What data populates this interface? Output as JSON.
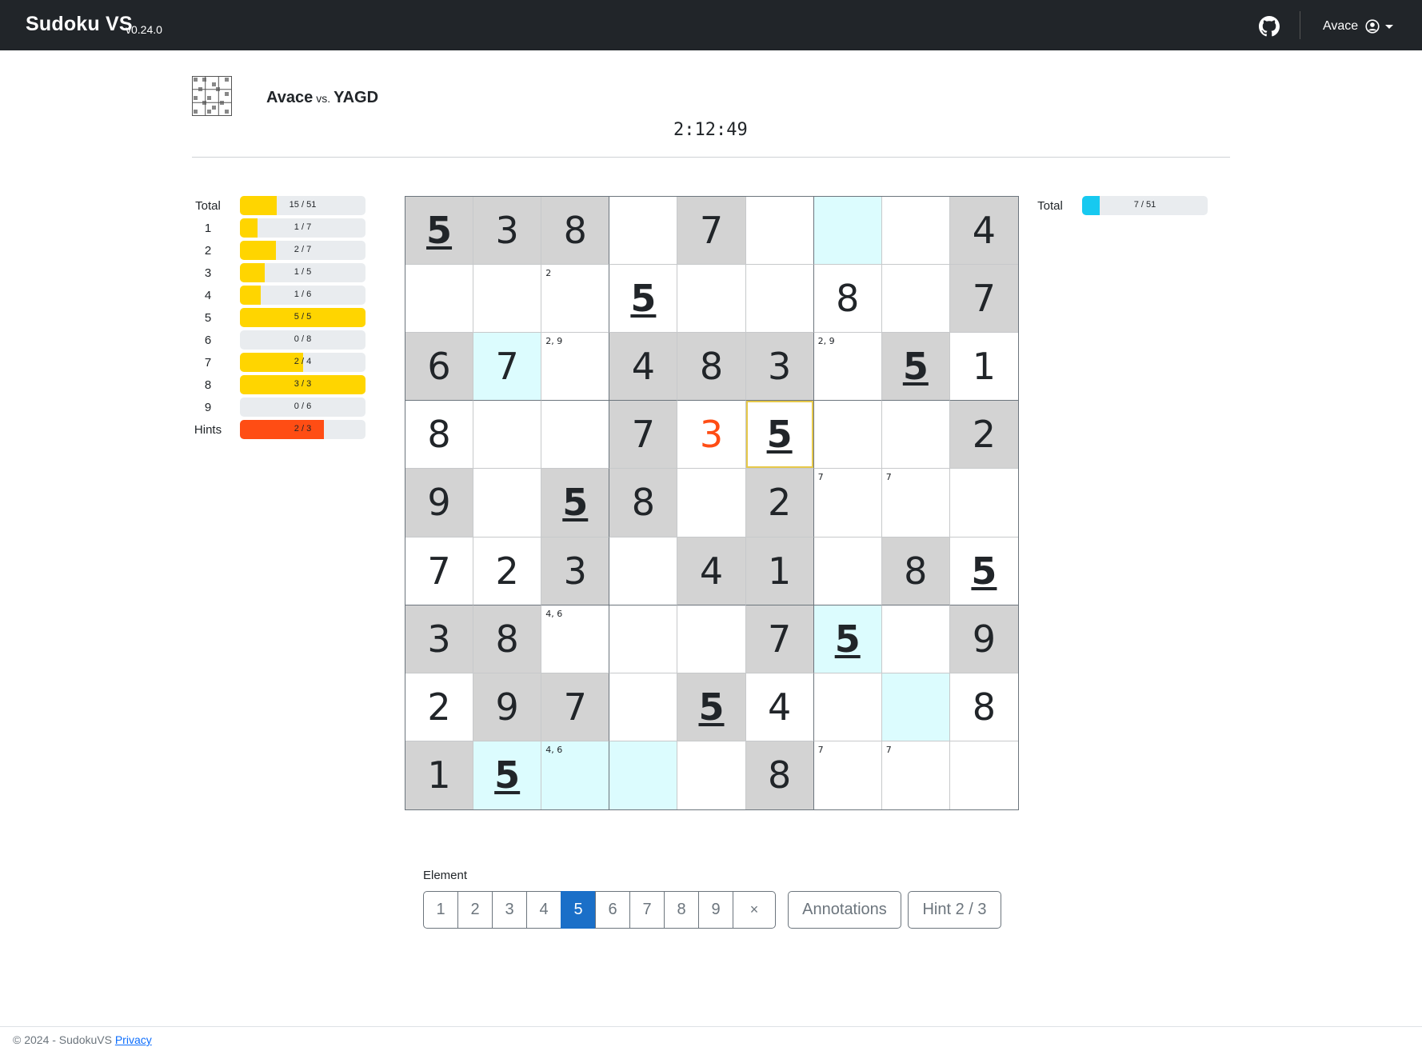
{
  "navbar": {
    "brand": "Sudoku VS",
    "version": "v0.24.0",
    "user": "Avace",
    "icons": [
      "github-icon",
      "user-circle-icon",
      "caret-down-icon"
    ]
  },
  "match": {
    "player1": "Avace",
    "vs": "vs.",
    "player2": "YAGD",
    "timer": "2:12:49"
  },
  "colors": {
    "navbar": "#212529",
    "player_fill": "#ffd500",
    "opponent_fill": "#17c9f0",
    "hints_fill": "#ff4d14",
    "highlight": "#dcfcfe",
    "given": "#d3d3d3",
    "error": "#ff4d14",
    "active_button": "#1a6fc8"
  },
  "player_stats": [
    {
      "label": "Total",
      "text": "15 / 51",
      "fraction": 0.294,
      "type": "normal"
    },
    {
      "label": "1",
      "text": "1 / 7",
      "fraction": 0.143,
      "type": "normal"
    },
    {
      "label": "2",
      "text": "2 / 7",
      "fraction": 0.286,
      "type": "normal"
    },
    {
      "label": "3",
      "text": "1 / 5",
      "fraction": 0.2,
      "type": "normal"
    },
    {
      "label": "4",
      "text": "1 / 6",
      "fraction": 0.167,
      "type": "normal"
    },
    {
      "label": "5",
      "text": "5 / 5",
      "fraction": 1.0,
      "type": "normal"
    },
    {
      "label": "6",
      "text": "0 / 8",
      "fraction": 0.0,
      "type": "normal"
    },
    {
      "label": "7",
      "text": "2 / 4",
      "fraction": 0.5,
      "type": "normal"
    },
    {
      "label": "8",
      "text": "3 / 3",
      "fraction": 1.0,
      "type": "normal"
    },
    {
      "label": "9",
      "text": "0 / 6",
      "fraction": 0.0,
      "type": "normal"
    },
    {
      "label": "Hints",
      "text": "2 / 3",
      "fraction": 0.667,
      "type": "hints"
    }
  ],
  "opponent_stats": [
    {
      "label": "Total",
      "text": "7 / 51",
      "fraction": 0.137,
      "type": "opponent"
    }
  ],
  "board": [
    [
      "5",
      "3",
      "8",
      "",
      "7",
      "",
      "",
      "",
      "4"
    ],
    [
      "",
      "",
      "",
      "5",
      "",
      "",
      "8",
      "",
      "7"
    ],
    [
      "6",
      "7",
      "",
      "4",
      "8",
      "3",
      "",
      "5",
      "1"
    ],
    [
      "8",
      "",
      "",
      "7",
      "3",
      "5",
      "",
      "",
      "2"
    ],
    [
      "9",
      "",
      "5",
      "8",
      "",
      "2",
      "",
      "",
      ""
    ],
    [
      "7",
      "2",
      "3",
      "",
      "4",
      "1",
      "",
      "8",
      "5"
    ],
    [
      "3",
      "8",
      "",
      "",
      "",
      "7",
      "5",
      "",
      "9"
    ],
    [
      "2",
      "9",
      "7",
      "",
      "5",
      "4",
      "",
      "",
      "8"
    ],
    [
      "1",
      "5",
      "",
      "",
      "",
      "8",
      "",
      "",
      ""
    ]
  ],
  "given": [
    [
      1,
      1,
      1,
      0,
      1,
      0,
      0,
      0,
      1
    ],
    [
      0,
      0,
      0,
      0,
      0,
      0,
      0,
      0,
      1
    ],
    [
      1,
      0,
      0,
      1,
      1,
      1,
      0,
      1,
      0
    ],
    [
      0,
      0,
      0,
      1,
      0,
      0,
      0,
      0,
      1
    ],
    [
      1,
      0,
      1,
      1,
      0,
      1,
      0,
      0,
      0
    ],
    [
      0,
      0,
      1,
      0,
      1,
      1,
      0,
      1,
      0
    ],
    [
      1,
      1,
      0,
      0,
      0,
      1,
      0,
      0,
      1
    ],
    [
      0,
      1,
      1,
      0,
      1,
      0,
      0,
      0,
      0
    ],
    [
      1,
      0,
      0,
      0,
      0,
      1,
      0,
      0,
      0
    ]
  ],
  "highlighted": [
    [
      0,
      6
    ],
    [
      2,
      1
    ],
    [
      6,
      6
    ],
    [
      7,
      7
    ],
    [
      8,
      1
    ],
    [
      8,
      2
    ],
    [
      8,
      3
    ]
  ],
  "selected": [
    3,
    5
  ],
  "error_cells": [
    [
      3,
      4
    ]
  ],
  "notes": [
    {
      "r": 1,
      "c": 2,
      "text": "2"
    },
    {
      "r": 2,
      "c": 2,
      "text": "2, 9"
    },
    {
      "r": 2,
      "c": 6,
      "text": "2, 9"
    },
    {
      "r": 4,
      "c": 6,
      "text": "7"
    },
    {
      "r": 4,
      "c": 7,
      "text": "7"
    },
    {
      "r": 6,
      "c": 2,
      "text": "4, 6"
    },
    {
      "r": 8,
      "c": 2,
      "text": "4, 6"
    },
    {
      "r": 8,
      "c": 6,
      "text": "7"
    },
    {
      "r": 8,
      "c": 7,
      "text": "7"
    }
  ],
  "controls": {
    "element_label": "Element",
    "numbers": [
      "1",
      "2",
      "3",
      "4",
      "5",
      "6",
      "7",
      "8",
      "9"
    ],
    "active_number": "5",
    "clear_label": "×",
    "annotations_label": "Annotations",
    "hint_label": "Hint 2 / 3"
  },
  "footer": {
    "copyright": "© 2024 - SudokuVS",
    "privacy": "Privacy"
  }
}
